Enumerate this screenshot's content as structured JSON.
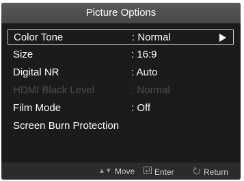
{
  "title": "Picture Options",
  "menu_items": [
    {
      "label": "Color Tone",
      "value": ": Normal",
      "selected": true,
      "enabled": true
    },
    {
      "label": "Size",
      "value": ": 16:9",
      "selected": false,
      "enabled": true
    },
    {
      "label": "Digital NR",
      "value": ": Auto",
      "selected": false,
      "enabled": true
    },
    {
      "label": "HDMI Black Level",
      "value": ": Normal",
      "selected": false,
      "enabled": false
    },
    {
      "label": "Film Mode",
      "value": ": Off",
      "selected": false,
      "enabled": true
    },
    {
      "label": "Screen Burn Protection",
      "value": "",
      "selected": false,
      "enabled": true
    }
  ],
  "footer": {
    "move_label": "Move",
    "enter_label": "Enter",
    "return_label": "Return"
  },
  "icons": {
    "selected_arrow": "arrow-right-icon",
    "move": "up-down-icon",
    "enter": "enter-icon",
    "return": "return-icon"
  },
  "colors": {
    "background": "#1b1b1b",
    "title_bar": "#4e4e4e",
    "text": "#ffffff",
    "disabled_text": "#4e4e4e",
    "selection_border": "#d7d7d7"
  }
}
